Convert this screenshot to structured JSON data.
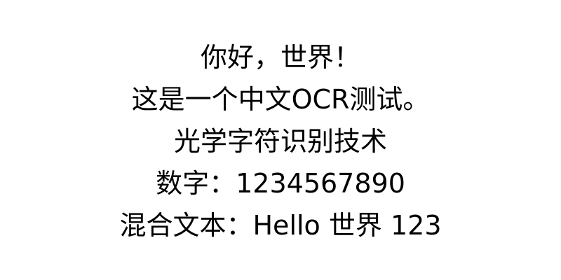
{
  "document": {
    "lines": [
      "你好，世界！",
      "这是一个中文OCR测试。",
      "光学字符识别技术",
      "数字：1234567890",
      "混合文本：Hello 世界 123"
    ]
  }
}
